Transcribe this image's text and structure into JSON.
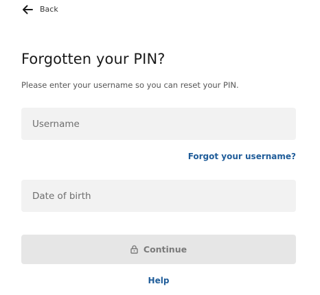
{
  "nav": {
    "back_label": "Back",
    "back_icon": "arrow-left-icon"
  },
  "form": {
    "title": "Forgotten your PIN?",
    "subtitle": "Please enter your username so you can reset your PIN.",
    "username": {
      "placeholder": "Username",
      "value": ""
    },
    "forgot_username_label": "Forgot your username?",
    "dob": {
      "placeholder": "Date of birth",
      "value": ""
    },
    "continue_label": "Continue",
    "continue_icon": "lock-icon",
    "help_label": "Help"
  },
  "colors": {
    "link": "#1f5c99",
    "field_background": "#f2f2f2",
    "button_disabled_background": "#e6e6e6",
    "button_disabled_text": "#7a7a7a"
  }
}
